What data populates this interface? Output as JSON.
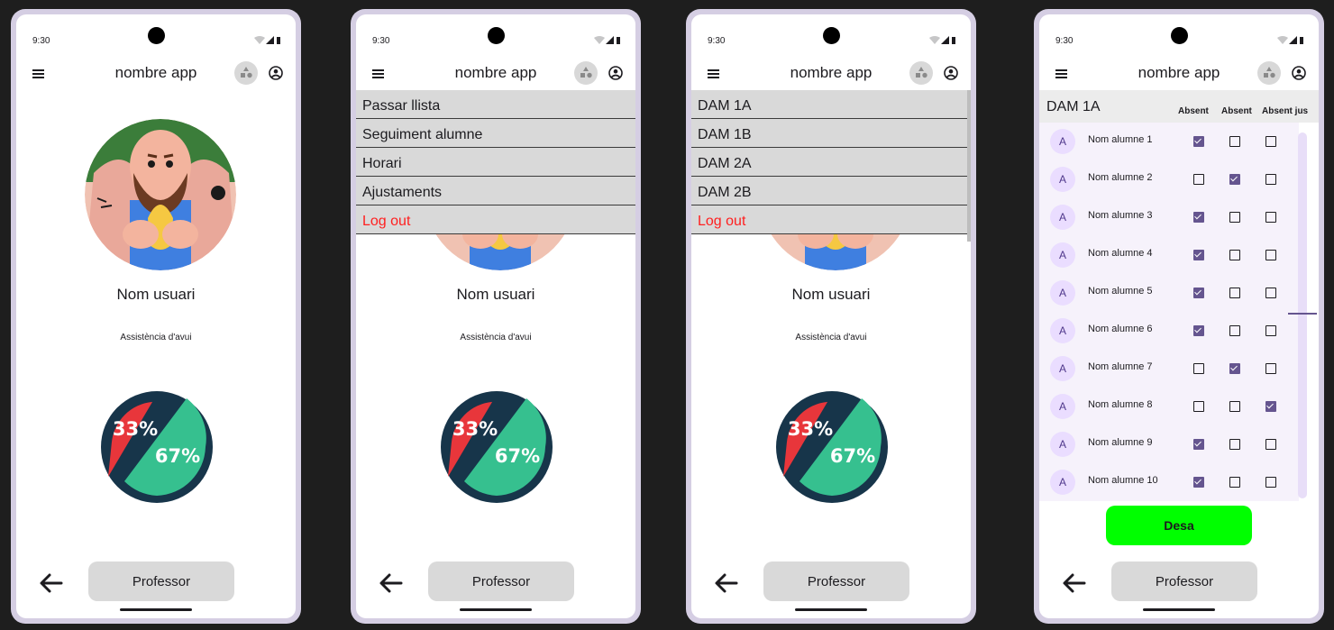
{
  "status": {
    "time": "9:30"
  },
  "app": {
    "title": "nombre app"
  },
  "profile": {
    "username": "Nom usuari",
    "attendance_label": "Assistència d'avui"
  },
  "stats": {
    "absent_percent": "33%",
    "present_percent": "67%",
    "absent_color": "#e8363b",
    "present_color": "#36c08f"
  },
  "footer": {
    "professor_label": "Professor"
  },
  "main_menu": [
    {
      "label": "Passar llista"
    },
    {
      "label": "Seguiment alumne"
    },
    {
      "label": "Horari"
    },
    {
      "label": "Ajustaments"
    },
    {
      "label": "Log out"
    }
  ],
  "class_menu": [
    {
      "label": "DAM 1A"
    },
    {
      "label": "DAM 1B"
    },
    {
      "label": "DAM 2A"
    },
    {
      "label": "DAM 2B"
    },
    {
      "label": "Log out"
    }
  ],
  "attendance": {
    "class_name": "DAM 1A",
    "columns": [
      "Absent",
      "Absent",
      "Absent jus"
    ],
    "students": [
      {
        "initial": "A",
        "name": "Nom alumne 1",
        "checks": [
          true,
          false,
          false
        ]
      },
      {
        "initial": "A",
        "name": "Nom alumne 2",
        "checks": [
          false,
          true,
          false
        ]
      },
      {
        "initial": "A",
        "name": "Nom alumne 3",
        "checks": [
          true,
          false,
          false
        ]
      },
      {
        "initial": "A",
        "name": "Nom alumne 4",
        "checks": [
          true,
          false,
          false
        ]
      },
      {
        "initial": "A",
        "name": "Nom alumne 5",
        "checks": [
          true,
          false,
          false
        ]
      },
      {
        "initial": "A",
        "name": "Nom alumne 6",
        "checks": [
          true,
          false,
          false
        ]
      },
      {
        "initial": "A",
        "name": "Nom alumne 7",
        "checks": [
          false,
          true,
          false
        ]
      },
      {
        "initial": "A",
        "name": "Nom alumne 8",
        "checks": [
          false,
          false,
          true
        ]
      },
      {
        "initial": "A",
        "name": "Nom alumne 9",
        "checks": [
          true,
          false,
          false
        ]
      },
      {
        "initial": "A",
        "name": "Nom alumne 10",
        "checks": [
          true,
          false,
          false
        ]
      }
    ],
    "save_label": "Desa",
    "save_color": "#00ff00"
  }
}
